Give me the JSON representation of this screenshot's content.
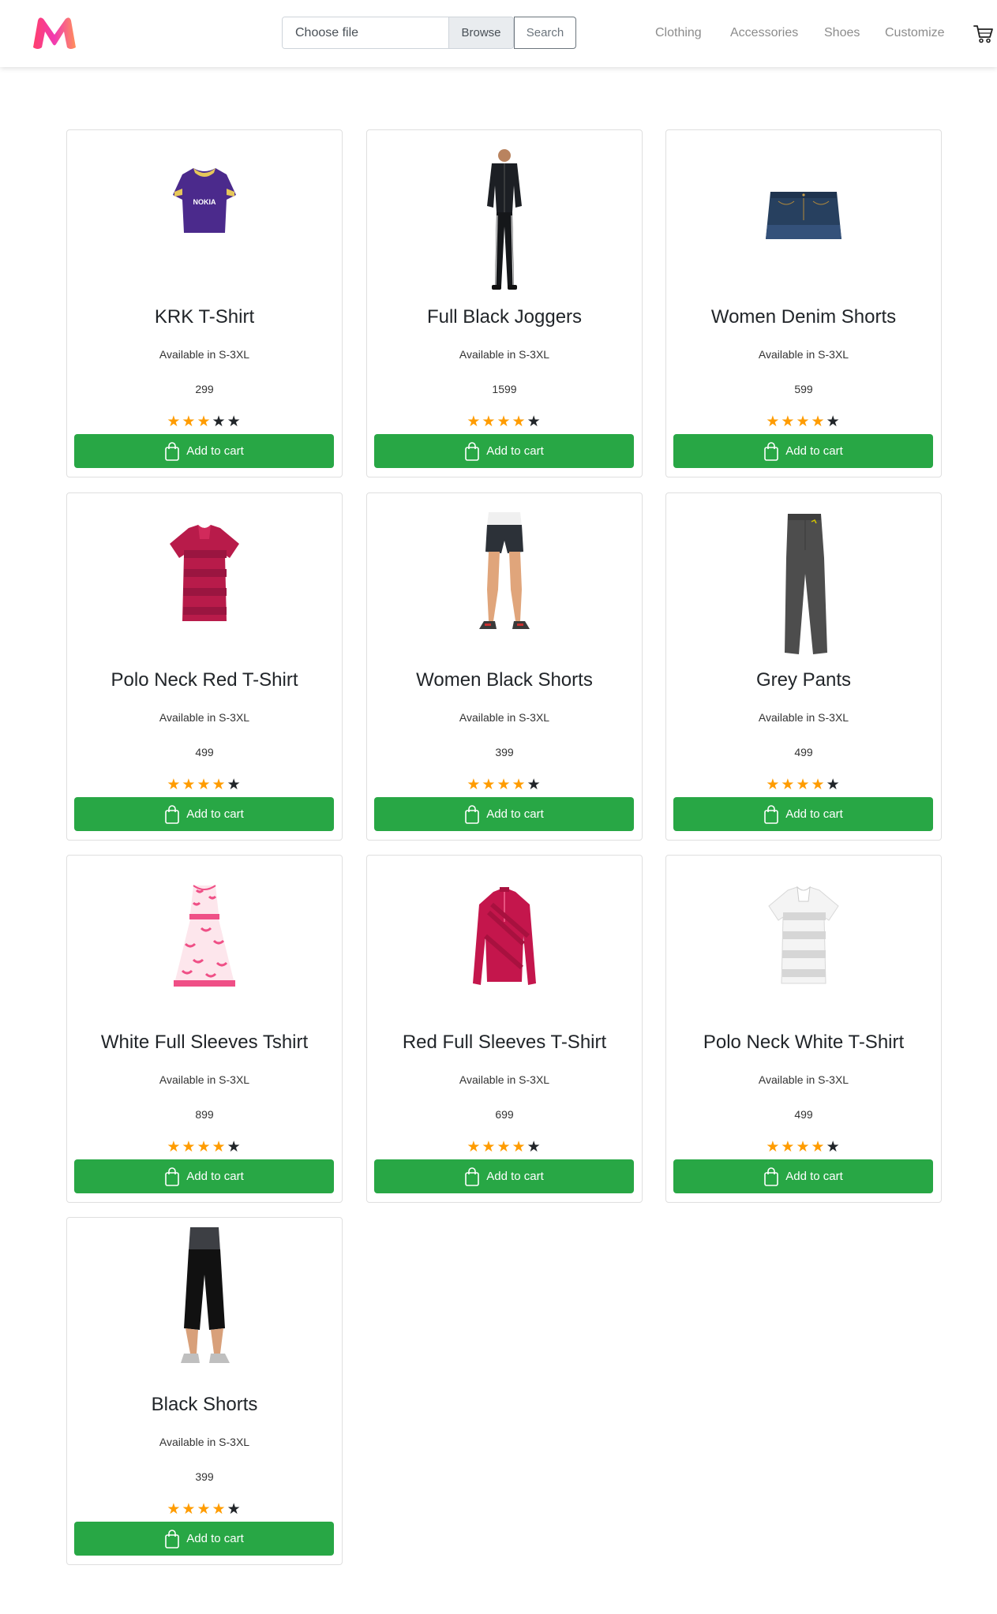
{
  "nav": {
    "file_input_text": "Choose file",
    "browse_label": "Browse",
    "search_label": "Search",
    "links": [
      "Clothing",
      "Accessories",
      "Shoes",
      "Customize"
    ],
    "cart_icon": "cart-icon",
    "logo_icon": "myntra-logo-icon"
  },
  "products": [
    {
      "name": "KRK T-Shirt",
      "availability": "Available in S-3XL",
      "price": "299",
      "rating": 3,
      "cta": "Add to cart",
      "image": "purple-jersey"
    },
    {
      "name": "Full Black Joggers",
      "availability": "Available in S-3XL",
      "price": "1599",
      "rating": 4,
      "cta": "Add to cart",
      "image": "tracksuit-model"
    },
    {
      "name": "Women Denim Shorts",
      "availability": "Available in S-3XL",
      "price": "599",
      "rating": 4,
      "cta": "Add to cart",
      "image": "denim-skirt"
    },
    {
      "name": "Polo Neck Red T-Shirt",
      "availability": "Available in S-3XL",
      "price": "499",
      "rating": 4,
      "cta": "Add to cart",
      "image": "red-polo"
    },
    {
      "name": "Women Black Shorts",
      "availability": "Available in S-3XL",
      "price": "399",
      "rating": 4,
      "cta": "Add to cart",
      "image": "black-shorts-model"
    },
    {
      "name": "Grey Pants",
      "availability": "Available in S-3XL",
      "price": "499",
      "rating": 4,
      "cta": "Add to cart",
      "image": "grey-pants"
    },
    {
      "name": "White Full Sleeves Tshirt",
      "availability": "Available in S-3XL",
      "price": "899",
      "rating": 4,
      "cta": "Add to cart",
      "image": "pink-floral-dress"
    },
    {
      "name": "Red Full Sleeves T-Shirt",
      "availability": "Available in S-3XL",
      "price": "699",
      "rating": 4,
      "cta": "Add to cart",
      "image": "red-jacket"
    },
    {
      "name": "Polo Neck White T-Shirt",
      "availability": "Available in S-3XL",
      "price": "499",
      "rating": 4,
      "cta": "Add to cart",
      "image": "white-polo"
    },
    {
      "name": "Black Shorts",
      "availability": "Available in S-3XL",
      "price": "399",
      "rating": 4,
      "cta": "Add to cart",
      "image": "black-capri-model"
    }
  ],
  "colors": {
    "button_green": "#28a745",
    "star_orange": "#ff9c00",
    "star_dark": "#212529",
    "nav_link": "#8c8c8c"
  }
}
